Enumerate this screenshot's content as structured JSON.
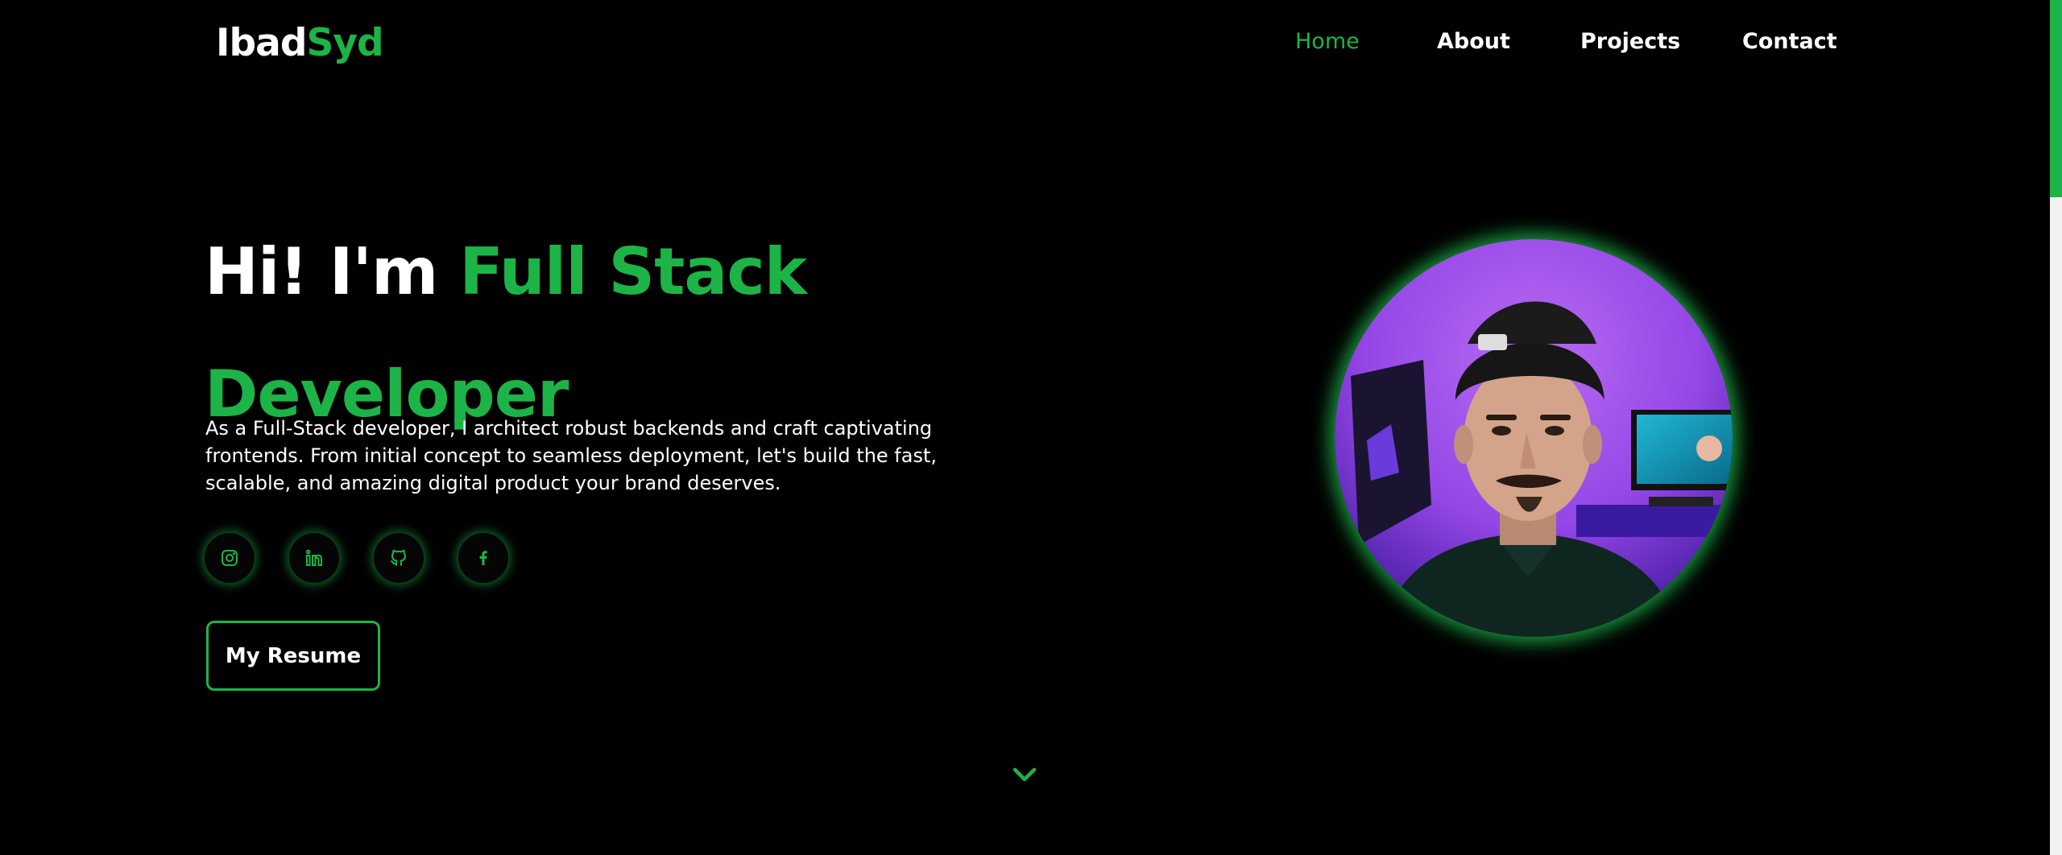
{
  "logo": {
    "first": "Ibad",
    "second": "Syd"
  },
  "nav": {
    "items": [
      {
        "label": "Home",
        "active": true
      },
      {
        "label": "About",
        "active": false
      },
      {
        "label": "Projects",
        "active": false
      },
      {
        "label": "Contact",
        "active": false
      }
    ]
  },
  "hero": {
    "title_plain": "Hi! I'm ",
    "title_accent_1": "Full Stack",
    "title_accent_2": "Developer",
    "description": "As a Full-Stack developer, I architect robust backends and craft captivating frontends. From initial concept to seamless deployment, let's build the fast, scalable, and amazing digital product your brand deserves.",
    "resume_label": "My Resume"
  },
  "socials": [
    {
      "icon": "instagram-icon"
    },
    {
      "icon": "linkedin-icon"
    },
    {
      "icon": "github-icon"
    },
    {
      "icon": "facebook-icon"
    }
  ],
  "colors": {
    "accent": "#1db447",
    "background": "#000000",
    "text": "#ffffff"
  }
}
